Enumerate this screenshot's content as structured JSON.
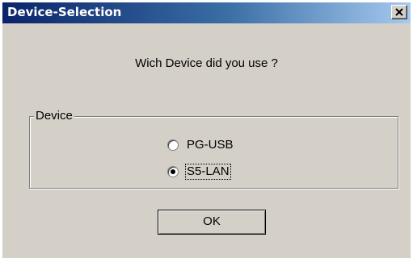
{
  "window": {
    "title": "Device-Selection",
    "close_label": "×"
  },
  "dialog": {
    "question": "Wich Device did you use ?",
    "group_label": "Device",
    "options": [
      {
        "label": "PG-USB",
        "selected": false
      },
      {
        "label": "S5-LAN",
        "selected": true
      }
    ],
    "ok_label": "OK"
  },
  "colors": {
    "title_bar_start": "#0a246a",
    "title_bar_end": "#a6caf0",
    "face": "#d4d0c8"
  },
  "icons": {
    "close": "close-icon"
  }
}
